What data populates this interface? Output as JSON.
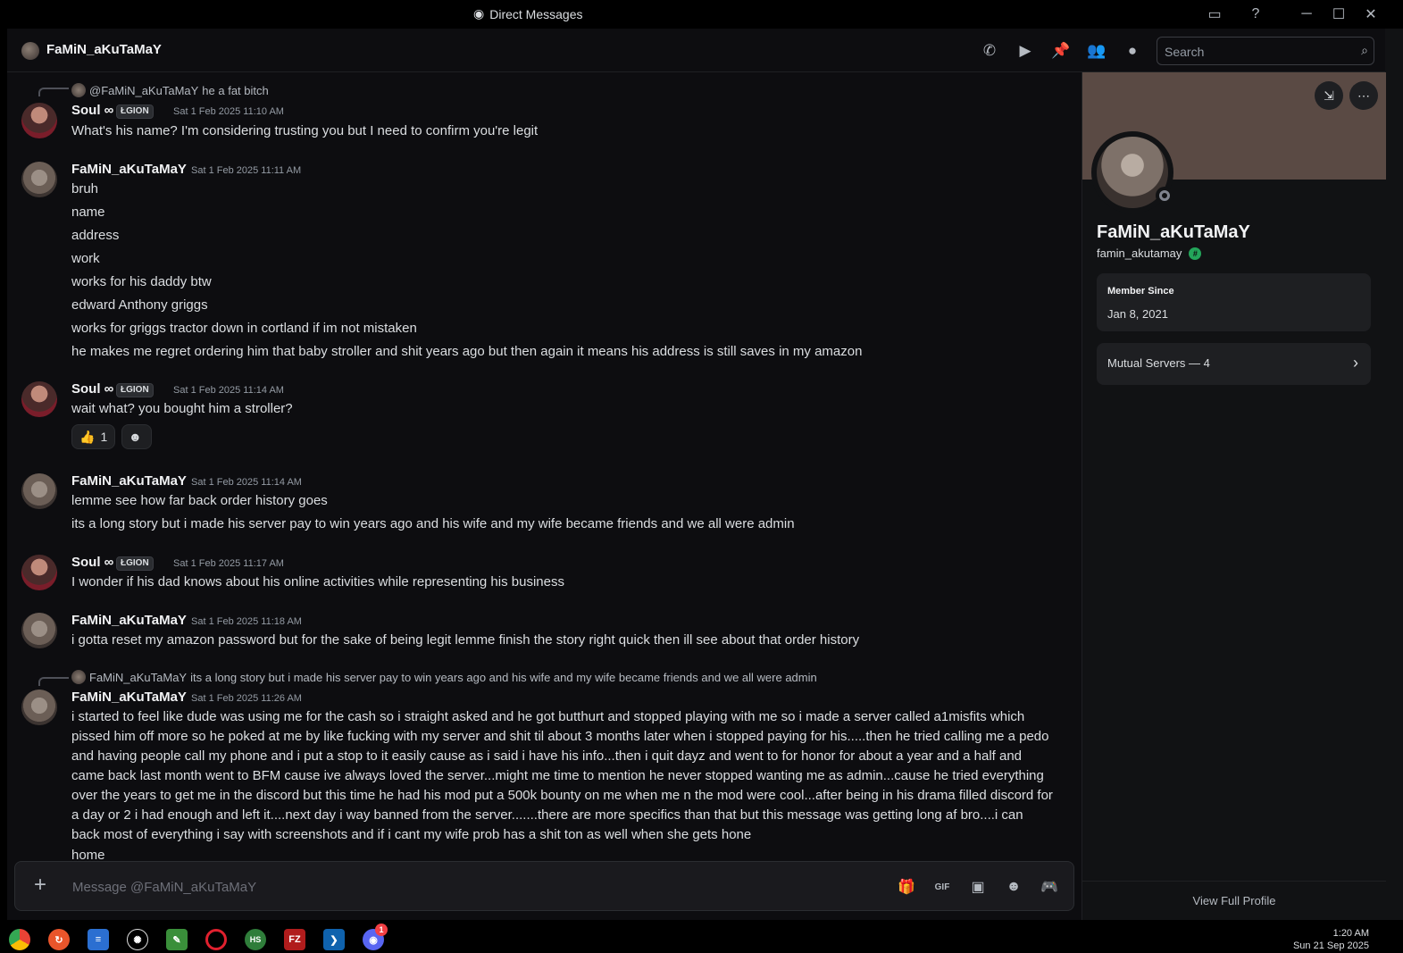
{
  "window": {
    "title": "Direct Messages"
  },
  "header": {
    "username": "FaMiN_aKuTaMaY"
  },
  "search": {
    "placeholder": "Search"
  },
  "badge_label": "ŁGION",
  "messages": [
    {
      "reply": {
        "name": "@FaMiN_aKuTaMaY",
        "text": "he a fat bitch"
      },
      "author": "Soul ∞",
      "timestamp": "Sat 1 Feb 2025 11:10 AM",
      "lines": [
        "What's his name? I'm considering trusting you but I need to confirm you're legit"
      ]
    },
    {
      "author": "FaMiN_aKuTaMaY",
      "timestamp": "Sat 1 Feb 2025 11:11 AM",
      "lines": [
        "bruh",
        "name",
        "address",
        "work",
        "works for his daddy btw",
        "edward Anthony griggs",
        "works for griggs tractor down in cortland if im not mistaken",
        "he makes me regret ordering him that baby stroller and shit years ago but then again it means his address is still saves in my amazon"
      ]
    },
    {
      "author": "Soul ∞",
      "timestamp": "Sat 1 Feb 2025 11:14 AM",
      "lines": [
        "wait what? you bought him a stroller?"
      ],
      "reaction": {
        "emoji": "👍",
        "count": "1"
      }
    },
    {
      "author": "FaMiN_aKuTaMaY",
      "timestamp": "Sat 1 Feb 2025 11:14 AM",
      "lines": [
        "lemme see how far back order history goes",
        "its a long story but i made his server pay to win years ago and his wife and my wife became friends and we all were admin"
      ]
    },
    {
      "author": "Soul ∞",
      "timestamp": "Sat 1 Feb 2025 11:17 AM",
      "lines": [
        "I wonder if his dad knows about his online activities while representing his business"
      ]
    },
    {
      "author": "FaMiN_aKuTaMaY",
      "timestamp": "Sat 1 Feb 2025 11:18 AM",
      "lines": [
        "i gotta reset my amazon password but for the sake of being legit lemme finish the story right quick then ill see about that order history"
      ]
    },
    {
      "reply": {
        "name": "FaMiN_aKuTaMaY",
        "text": "its a long story but i made his server pay to win years ago and his wife and my wife became friends and we all were admin"
      },
      "author": "FaMiN_aKuTaMaY",
      "timestamp": "Sat 1 Feb 2025 11:26 AM",
      "paragraph": "i started to feel like dude was using me for the cash so i straight asked and he got butthurt and stopped playing with me so i made a server called a1misfits which pissed him off more so he poked at me by like fucking with my server and shit til about 3 months later when i stopped paying for his.....then he tried calling me a pedo and having people call my phone and i put a stop to it easily cause as i said i have his info...then i quit dayz and went to for honor for about a year and a half and came back last month went to BFM cause ive always loved the server...might me time to mention he never stopped wanting me as admin...cause he tried everything over the years to get me in the discord but this time he had his mod put a 500k bounty on me when me n the mod were cool...after being in his drama filled discord for a day or 2 i had enough and left it....next day i way banned from the server.......there are more specifics than that but this message was getting long af bro....i can back most of everything i say with screenshots and if i cant my wife prob has a shit ton as well when she gets hone",
      "lines": [
        "home"
      ]
    }
  ],
  "composer": {
    "placeholder": "Message @FaMiN_aKuTaMaY"
  },
  "profile": {
    "display_name": "FaMiN_aKuTaMaY",
    "handle": "famin_akutamay",
    "member_since_label": "Member Since",
    "member_since": "Jan 8, 2021",
    "mutual_servers": "Mutual Servers — 4",
    "view_full": "View Full Profile"
  },
  "taskbar": {
    "time": "1:20 AM",
    "date": "Sun 21 Sep 2025",
    "notification_count": "1"
  },
  "colors": {
    "accent": "#5865f2",
    "online": "#23a55a",
    "banner": "#5a4a44"
  }
}
